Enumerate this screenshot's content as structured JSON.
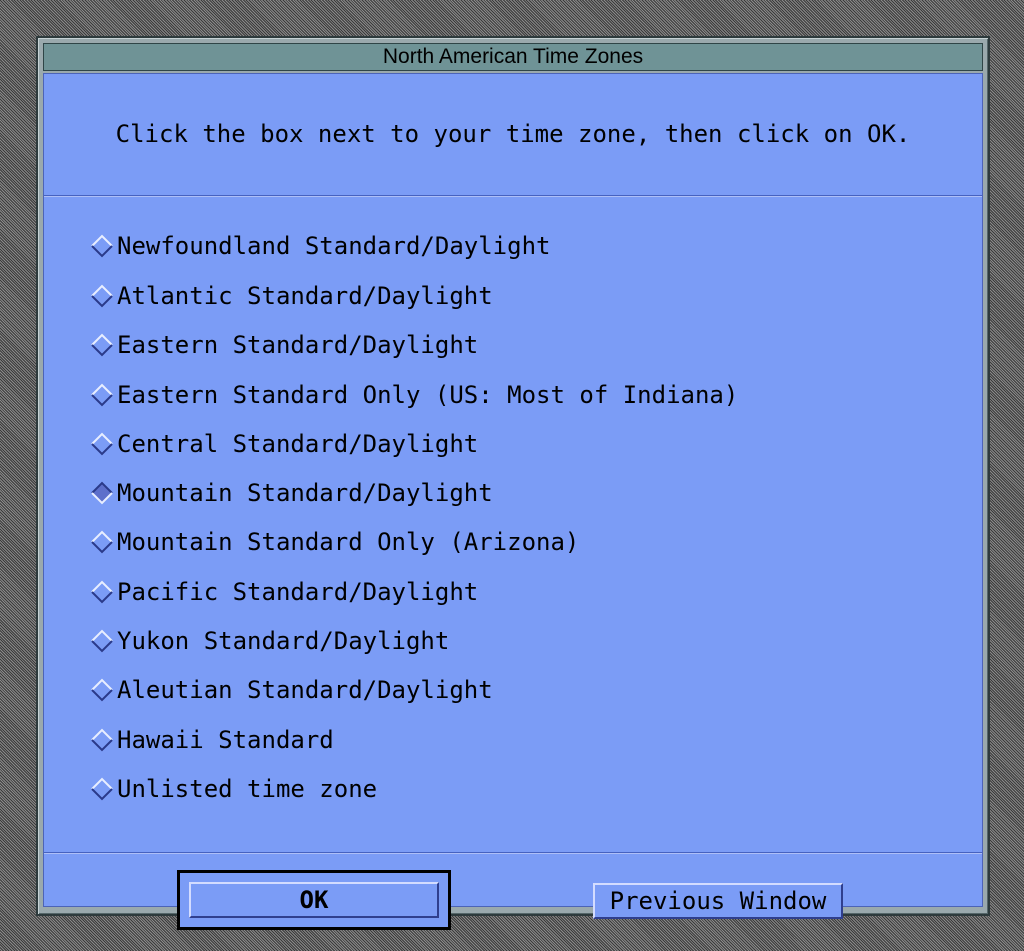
{
  "window": {
    "title": "North American Time Zones"
  },
  "instruction": "Click the box next to your time zone, then click on OK.",
  "selected_index": 5,
  "options": [
    {
      "label": "Newfoundland Standard/Daylight",
      "selected": false
    },
    {
      "label": "Atlantic Standard/Daylight",
      "selected": false
    },
    {
      "label": "Eastern Standard/Daylight",
      "selected": false
    },
    {
      "label": "Eastern Standard Only (US: Most of Indiana)",
      "selected": false
    },
    {
      "label": "Central Standard/Daylight",
      "selected": false
    },
    {
      "label": "Mountain Standard/Daylight",
      "selected": true
    },
    {
      "label": "Mountain Standard Only (Arizona)",
      "selected": false
    },
    {
      "label": "Pacific Standard/Daylight",
      "selected": false
    },
    {
      "label": "Yukon Standard/Daylight",
      "selected": false
    },
    {
      "label": "Aleutian Standard/Daylight",
      "selected": false
    },
    {
      "label": "Hawaii Standard",
      "selected": false
    },
    {
      "label": "Unlisted time zone",
      "selected": false
    }
  ],
  "buttons": {
    "ok_label": "OK",
    "previous_label": "Previous Window"
  },
  "icons": {
    "radio": "diamond-radio-icon"
  },
  "colors": {
    "panel_background": "#7b9cf6",
    "titlebar": "#6f9396",
    "window_frame": "#9aa9ad",
    "radio_selected_fill": "#5d6fcb"
  }
}
